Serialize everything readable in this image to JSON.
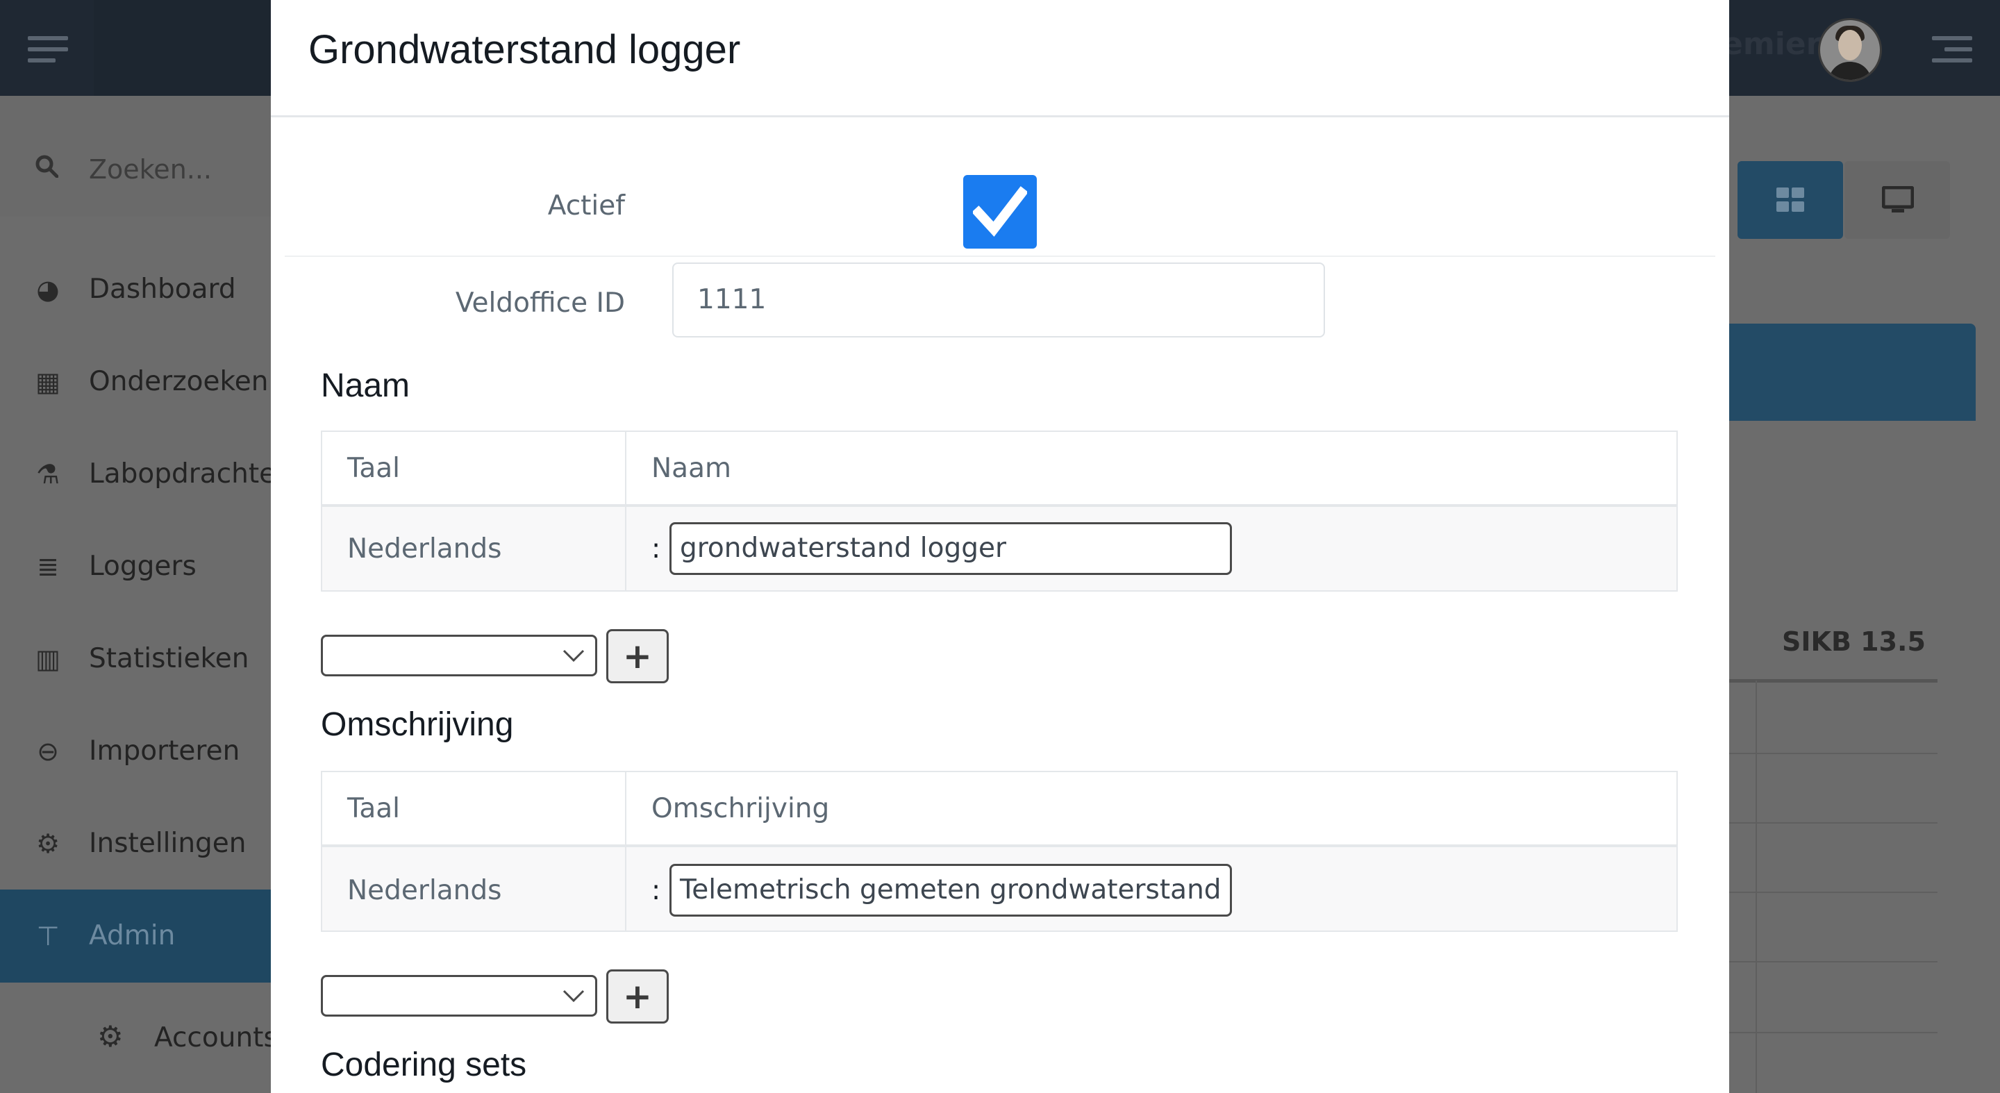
{
  "background": {
    "search_placeholder": "Zoeken...",
    "nav": [
      {
        "label": "Dashboard",
        "icon": "dashboard-icon"
      },
      {
        "label": "Onderzoeken",
        "icon": "grid-icon"
      },
      {
        "label": "Labopdrachten",
        "icon": "flask-icon"
      },
      {
        "label": "Loggers",
        "icon": "database-icon"
      },
      {
        "label": "Statistieken",
        "icon": "bar-chart-icon"
      },
      {
        "label": "Importeren",
        "icon": "import-icon"
      },
      {
        "label": "Instellingen",
        "icon": "gear-icon"
      },
      {
        "label": "Admin",
        "icon": "sitemap-icon",
        "active": true
      }
    ],
    "sub_item": {
      "label": "Accounts",
      "icon": "gears-icon"
    },
    "user_name_partial": "emier",
    "table_header": "SIKB 13.5"
  },
  "modal": {
    "title": "Grondwaterstand logger",
    "active_label": "Actief",
    "active_checked": true,
    "veldoffice_label": "Veldoffice ID",
    "veldoffice_value": "1111",
    "naam_section": {
      "title": "Naam",
      "col_lang": "Taal",
      "col_value": "Naam",
      "rows": [
        {
          "lang": "Nederlands",
          "value": "grondwaterstand logger"
        }
      ]
    },
    "omschrijving_section": {
      "title": "Omschrijving",
      "col_lang": "Taal",
      "col_value": "Omschrijving",
      "rows": [
        {
          "lang": "Nederlands",
          "value": "Telemetrisch gemeten grondwaterstand ter be"
        }
      ]
    },
    "colon": ":",
    "add_symbol": "+",
    "codering_title": "Codering sets"
  },
  "colors": {
    "topbar": "#1f2833",
    "active_nav": "#1f4761",
    "checkbox": "#1a7cf0"
  }
}
